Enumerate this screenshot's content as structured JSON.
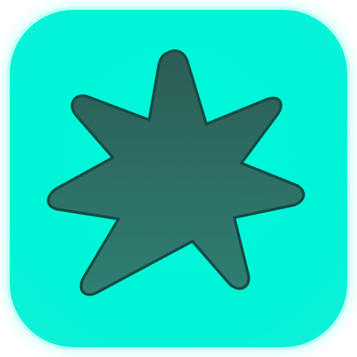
{
  "app_icon": {
    "name": "star-burst-app-icon",
    "background_color": "#00F7DA",
    "background_glow_color": "#BFFFF5",
    "symbol": "seven-point-star-burst",
    "symbol_fill_top": "#2A5B53",
    "symbol_fill_bottom": "#2D7F73",
    "symbol_outline": "#124A42"
  }
}
